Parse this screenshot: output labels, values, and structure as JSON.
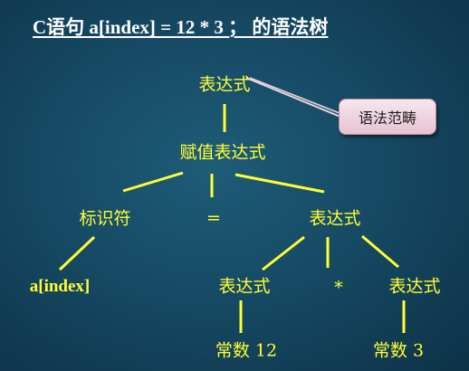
{
  "title": "C语句 a[index] = 12 * 3 ； 的语法树",
  "callout": "语法范畴",
  "nodes": {
    "root": "表达式",
    "assign": "赋值表达式",
    "ident": "标识符",
    "equals": "=",
    "rhs": "表达式",
    "a_index": "a[index]",
    "expr_left": "表达式",
    "star": "*",
    "expr_right": "表达式",
    "const_12": "常数 12",
    "const_3": "常数 3"
  },
  "colors": {
    "node_text": "#ffff33",
    "edge": "#ffff33",
    "title": "#ffffff",
    "callout_bg": "#f2d9e4"
  }
}
